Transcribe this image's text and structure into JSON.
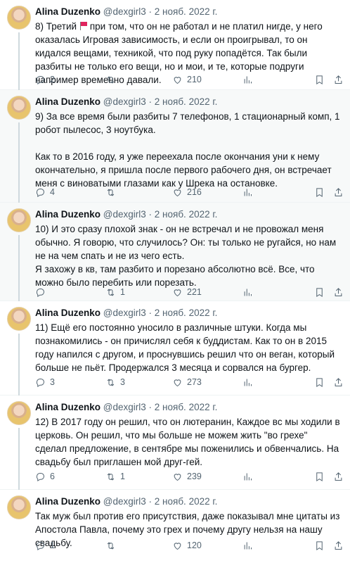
{
  "tweets": [
    {
      "name": "Alina Duzenko",
      "handle": "@dexgirl3",
      "sep": "·",
      "date": "2 нояб. 2022 г.",
      "text_pre": "8) Третий",
      "text": "при том, что он не работал  и не платил нигде, у него оказалась Игровая зависимость, и если он проигрывал, то он кидался вещами, техникой, что под руку попадётся. Так были разбиты не только его вещи, но и мои, и те, которые подруги например временно давали.",
      "replies": "2",
      "retweets": "",
      "likes": "210",
      "views": ""
    },
    {
      "name": "Alina Duzenko",
      "handle": "@dexgirl3",
      "sep": "·",
      "date": "2 нояб. 2022 г.",
      "text": "9) За все время были разбиты 7 телефонов, 1 стационарный комп, 1 робот пылесос, 3 ноутбука.\n\nКак то в 2016 году, я уже переехала после окончания уни к нему окончательно,  я пришла после первого рабочего дня, он встречает меня с виноватыми глазами как у Шрека на остановке.",
      "replies": "4",
      "retweets": "",
      "likes": "216",
      "views": ""
    },
    {
      "name": "Alina Duzenko",
      "handle": "@dexgirl3",
      "sep": "·",
      "date": "2 нояб. 2022 г.",
      "text": "10) И это сразу плохой знак - он не встречал и не провожал меня обычно. Я говорю, что случилось? Он: ты только не ругайся, но нам не на чем спать и не из чего есть.\nЯ захожу в кв, там разбито и порезано абсолютно всё. Все, что можно было перебить или порезать.",
      "replies": "",
      "retweets": "1",
      "likes": "221",
      "views": ""
    },
    {
      "name": "Alina Duzenko",
      "handle": "@dexgirl3",
      "sep": "·",
      "date": "2 нояб. 2022 г.",
      "text": "11) Ещё его постоянно уносило в различные штуки. Когда мы познакомились - он причислял себя к буддистам. Как то он в 2015 году напился с другом, и проснувшись решил что он веган, который больше не пьёт. Продержался 3 месяца и сорвался на бургер.",
      "replies": "3",
      "retweets": "3",
      "likes": "273",
      "views": ""
    },
    {
      "name": "Alina Duzenko",
      "handle": "@dexgirl3",
      "sep": "·",
      "date": "2 нояб. 2022 г.",
      "text": "12) В 2017 году он решил, что он лютеранин, Каждое вс мы ходили в церковь. Он решил, что мы больше не можем жить \"во грехе\" сделал предложение, в сентябре мы поженились и обвенчались. На свадьбу был приглашен мой друг-гей.",
      "replies": "6",
      "retweets": "1",
      "likes": "239",
      "views": ""
    },
    {
      "name": "Alina Duzenko",
      "handle": "@dexgirl3",
      "sep": "·",
      "date": "2 нояб. 2022 г.",
      "text": "Так муж был против его присутствия, даже показывал мне цитаты из Апостола Павла, почему это грех и почему другу нельзя на нашу свадьбу.",
      "replies": "1",
      "retweets": "",
      "likes": "120",
      "views": ""
    }
  ]
}
